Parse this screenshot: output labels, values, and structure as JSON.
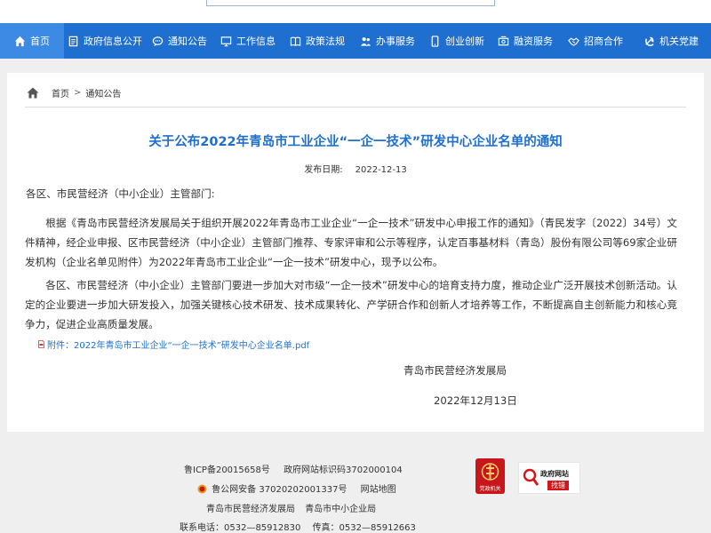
{
  "nav": {
    "items": [
      {
        "label": "首页",
        "icon": "home-icon",
        "active": true
      },
      {
        "label": "政府信息公开",
        "icon": "document-icon"
      },
      {
        "label": "通知公告",
        "icon": "chat-icon"
      },
      {
        "label": "工作信息",
        "icon": "monitor-icon"
      },
      {
        "label": "政策法规",
        "icon": "book-icon"
      },
      {
        "label": "办事服务",
        "icon": "people-icon"
      },
      {
        "label": "创业创新",
        "icon": "phone-icon"
      },
      {
        "label": "融资服务",
        "icon": "money-icon"
      },
      {
        "label": "招商合作",
        "icon": "handshake-icon"
      },
      {
        "label": "机关党建",
        "icon": "party-emblem-icon"
      }
    ]
  },
  "breadcrumb": {
    "home": "首页",
    "separator": ">",
    "current": "通知公告"
  },
  "article": {
    "title": "关于公布2022年青岛市工业企业“一企一技术”研发中心企业名单的通知",
    "date_label": "发布日期:",
    "date_value": "2022-12-13",
    "salutation": "各区、市民营经济（中小企业）主管部门:",
    "paragraph1": "根据《青岛市民营经济发展局关于组织开展2022年青岛市工业企业“一企一技术”研发中心申报工作的通知》（青民发字〔2022〕34号）文件精神，经企业申报、区市民营经济（中小企业）主管部门推荐、专家评审和公示等程序，认定百事基材料（青岛）股份有限公司等69家企业研发机构（企业名单见附件）为2022年青岛市工业企业“一企一技术”研发中心，现予以公布。",
    "paragraph2": "各区、市民营经济（中小企业）主管部门要进一步加大对市级“一企一技术”研发中心的培育支持力度，推动企业广泛开展技术创新活动。认定的企业要进一步加大研发投入，加强关键核心技术研发、技术成果转化、产学研合作和创新人才培养等工作，不断提高自主创新能力和核心竞争力，促进企业高质量发展。",
    "attachment": "附件：2022年青岛市工业企业“一企一技术”研发中心企业名单.pdf",
    "signature": "青岛市民营经济发展局",
    "sign_date": "2022年12月13日"
  },
  "footer": {
    "icp": "鲁ICP备20015658号",
    "gov_id": "政府网站标识码3702000104",
    "police": "鲁公网安备 37020202001337号",
    "sitemap": "网站地图",
    "org1": "青岛市民营经济发展局",
    "org2": "青岛市中小企业局",
    "phone": "联系电话：0532—85912830",
    "fax": "传真：0532—85912663",
    "logo_red_label": "党政机关",
    "logo_gov_title": "政府网站",
    "logo_gov_sub": "找错"
  },
  "colors": {
    "nav_bg": "#1f6fd0",
    "nav_active": "#3d8ae5",
    "title": "#1f6fd0",
    "logo_red": "#c8161d"
  }
}
